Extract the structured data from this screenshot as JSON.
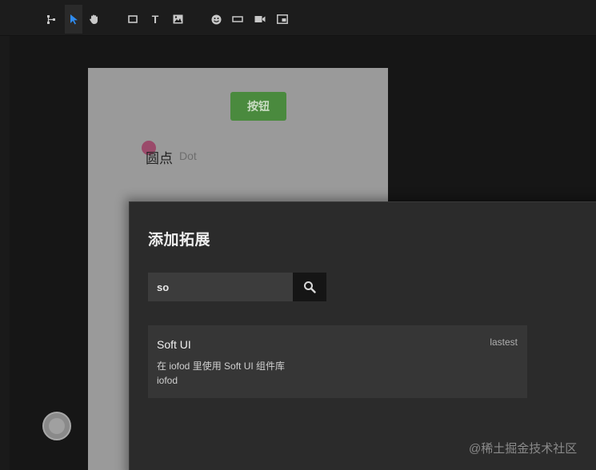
{
  "toolbar": {
    "tools": [
      {
        "name": "tree-icon"
      },
      {
        "name": "pointer-icon",
        "active": true
      },
      {
        "name": "hand-icon"
      },
      {
        "name": "rectangle-icon"
      },
      {
        "name": "text-icon",
        "glyph": "T"
      },
      {
        "name": "image-icon"
      },
      {
        "name": "emoji-icon"
      },
      {
        "name": "button-shape-icon"
      },
      {
        "name": "video-icon"
      },
      {
        "name": "embed-icon"
      }
    ],
    "active_color": "#2f8cf0"
  },
  "artboard": {
    "button_label": "按钮",
    "button_color": "#4a8a3e",
    "dot_label": "圆点",
    "dot_sub": "Dot"
  },
  "dialog": {
    "title": "添加拓展",
    "search": {
      "value": "so",
      "icon": "search-icon"
    },
    "results": [
      {
        "name": "Soft UI",
        "version": "lastest",
        "description": "在 iofod 里使用 Soft UI 组件库",
        "author": "iofod"
      }
    ]
  },
  "watermark": "@稀土掘金技术社区"
}
